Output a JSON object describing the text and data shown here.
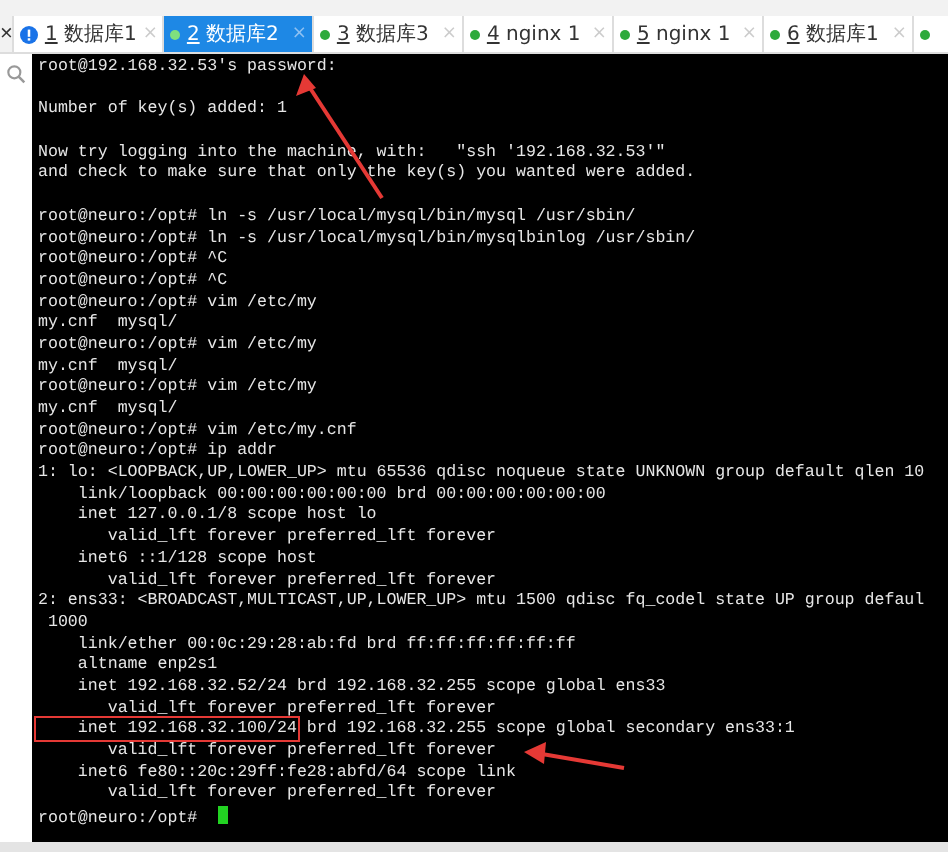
{
  "tabs": [
    {
      "number": "1",
      "label": "数据库1",
      "kind": "info",
      "selected": false
    },
    {
      "number": "2",
      "label": "数据库2",
      "kind": "connected",
      "selected": true
    },
    {
      "number": "3",
      "label": "数据库3",
      "kind": "connected",
      "selected": false
    },
    {
      "number": "4",
      "label": "nginx 1",
      "kind": "connected",
      "selected": false
    },
    {
      "number": "5",
      "label": "nginx 1",
      "kind": "connected",
      "selected": false
    },
    {
      "number": "6",
      "label": "数据库1",
      "kind": "connected",
      "selected": false
    },
    {
      "kind": "connected",
      "selected": false
    }
  ],
  "close_all": "×",
  "tab_close": "×",
  "terminal": {
    "lines": [
      {
        "parts": [
          {
            "text": "root@192.168.32.53's password:"
          }
        ]
      },
      {
        "kind": "blank"
      },
      {
        "parts": [
          {
            "text": "Number of key(s) added: 1"
          }
        ]
      },
      {
        "kind": "blank"
      },
      {
        "parts": [
          {
            "text": "Now try logging into the machine, with:   \"ssh '192.168.32.53'\""
          }
        ]
      },
      {
        "parts": [
          {
            "text": "and check to make sure that only the key(s) you wanted were added."
          }
        ]
      },
      {
        "kind": "blank"
      },
      {
        "parts": [
          {
            "text": "root@neuro:/opt# ln -s /usr/local/mysql/bin/mysql /usr/sbin/"
          }
        ]
      },
      {
        "parts": [
          {
            "text": "root@neuro:/opt# ln -s /usr/local/mysql/bin/mysqlbinlog /usr/sbin/"
          }
        ]
      },
      {
        "parts": [
          {
            "text": "root@neuro:/opt# ^C"
          }
        ]
      },
      {
        "parts": [
          {
            "text": "root@neuro:/opt# ^C"
          }
        ]
      },
      {
        "parts": [
          {
            "text": "root@neuro:/opt# vim /etc/my"
          }
        ]
      },
      {
        "parts": [
          {
            "text": "my.cnf  mysql/"
          }
        ]
      },
      {
        "parts": [
          {
            "text": "root@neuro:/opt# vim /etc/my"
          }
        ]
      },
      {
        "parts": [
          {
            "text": "my.cnf  mysql/"
          }
        ]
      },
      {
        "parts": [
          {
            "text": "root@neuro:/opt# vim /etc/my"
          }
        ]
      },
      {
        "parts": [
          {
            "text": "my.cnf  mysql/"
          }
        ]
      },
      {
        "parts": [
          {
            "text": "root@neuro:/opt# vim /etc/my.cnf"
          }
        ]
      },
      {
        "parts": [
          {
            "text": "root@neuro:/opt# ip addr"
          }
        ]
      },
      {
        "parts": [
          {
            "text": "1: lo: <LOOPBACK,UP,LOWER_UP> mtu 65536 qdisc noqueue state UNKNOWN group default qlen 10"
          }
        ]
      },
      {
        "parts": [
          {
            "text": "    link/loopback 00:00:00:00:00:00 brd 00:00:00:00:00:00"
          }
        ]
      },
      {
        "parts": [
          {
            "text": "    inet 127.0.0.1/8 scope host lo"
          }
        ]
      },
      {
        "parts": [
          {
            "text": "       valid_lft forever preferred_lft forever"
          }
        ]
      },
      {
        "parts": [
          {
            "text": "    inet6 ::1/128 scope host"
          }
        ]
      },
      {
        "parts": [
          {
            "text": "       valid_lft forever preferred_lft forever"
          }
        ]
      },
      {
        "parts": [
          {
            "text": "2: ens33: <BROADCAST,MULTICAST,UP,LOWER_UP> mtu 1500 qdisc fq_codel state UP group defaul"
          }
        ]
      },
      {
        "parts": [
          {
            "text": " 1000"
          }
        ]
      },
      {
        "parts": [
          {
            "text": "    link/ether 00:0c:29:28:ab:fd brd ff:ff:ff:ff:ff:ff"
          }
        ]
      },
      {
        "parts": [
          {
            "text": "    altname enp2s1"
          }
        ]
      },
      {
        "parts": [
          {
            "text": "    inet 192.168.32.52/24 brd 192.168.32.255 scope global ens33"
          }
        ]
      },
      {
        "parts": [
          {
            "text": "       valid_lft forever preferred_lft forever"
          }
        ]
      },
      {
        "parts": [
          {
            "text": "    inet 192.168.32.100/24",
            "boxed": true
          },
          {
            "text": " brd 192.168.32.255 scope global secondary ens33:1"
          }
        ]
      },
      {
        "parts": [
          {
            "text": "       valid_lft forever preferred_lft forever"
          }
        ]
      },
      {
        "parts": [
          {
            "text": "    inet6 fe80::20c:29ff:fe28:abfd/64 scope link"
          }
        ]
      },
      {
        "parts": [
          {
            "text": "       valid_lft forever preferred_lft forever"
          }
        ]
      },
      {
        "parts": [
          {
            "text": "root@neuro:/opt# "
          }
        ],
        "cursor": true
      }
    ]
  }
}
